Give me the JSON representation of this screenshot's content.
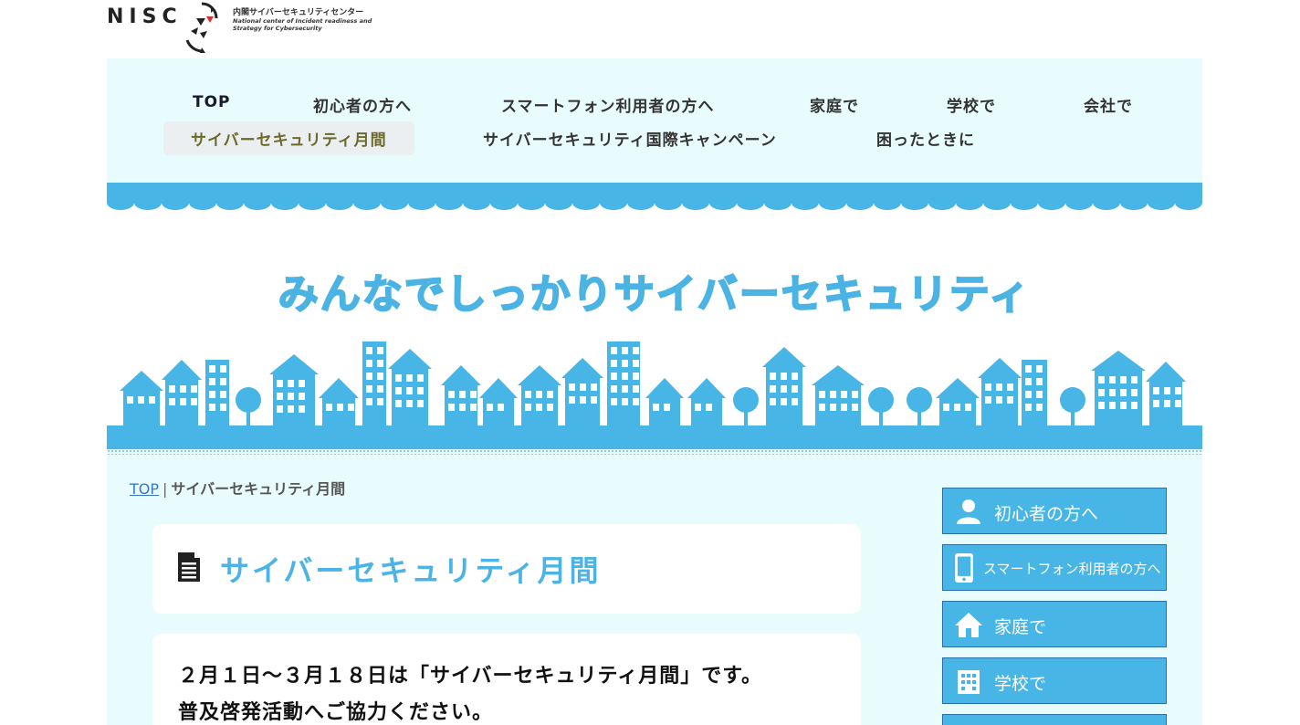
{
  "logo": {
    "letters": "NISC",
    "jp_name": "内閣サイバーセキュリティセンター",
    "en_line1": "National center of Incident readiness and",
    "en_line2": "Strategy for Cybersecurity"
  },
  "nav": {
    "items": [
      {
        "label": "TOP"
      },
      {
        "label": "初心者の方へ"
      },
      {
        "label": "スマートフォン利用者の方へ"
      },
      {
        "label": "家庭で"
      },
      {
        "label": "学校で"
      },
      {
        "label": "会社で"
      },
      {
        "label": "サイバーセキュリティ月間"
      },
      {
        "label": "サイバーセキュリティ国際キャンペーン"
      },
      {
        "label": "困ったときに"
      }
    ]
  },
  "hero": {
    "title": "みんなでしっかりサイバーセキュリティ"
  },
  "breadcrumb": {
    "home": "TOP",
    "separator": "|",
    "current": "サイバーセキュリティ月間"
  },
  "page": {
    "title": "サイバーセキュリティ月間",
    "line1": "２月１日～３月１８日は「サイバーセキュリティ月間」です。",
    "line2": "普及啓発活動へご協力ください。"
  },
  "sidebar": {
    "items": [
      {
        "label": "初心者の方へ",
        "icon": "person-icon"
      },
      {
        "label": "スマートフォン利用者の方へ",
        "icon": "smartphone-icon"
      },
      {
        "label": "家庭で",
        "icon": "house-icon"
      },
      {
        "label": "学校で",
        "icon": "building-icon"
      }
    ]
  },
  "colors": {
    "accent": "#47b5e6",
    "nav_bg": "#e8fbfd",
    "title_blue": "#4bb3e6"
  }
}
